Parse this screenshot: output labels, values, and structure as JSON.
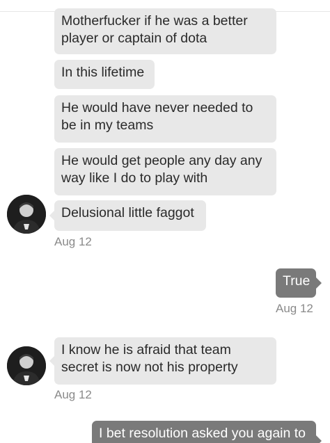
{
  "conversation": {
    "messages": [
      {
        "lines": [
          "Motherfucker if he was a better",
          "player or captain of dota"
        ]
      },
      {
        "lines": [
          "In this lifetime"
        ]
      },
      {
        "lines": [
          "He would have never needed to",
          "be in my teams"
        ]
      },
      {
        "lines": [
          "He would get people any day any",
          "way like I do to play with"
        ]
      },
      {
        "lines": [
          "Delusional little faggot"
        ],
        "timestamp": "Aug 12"
      },
      {
        "lines": [
          "True"
        ],
        "timestamp": "Aug 12"
      },
      {
        "lines": [
          "I know he is afraid that team",
          "secret is now not his property"
        ],
        "timestamp": "Aug 12"
      },
      {
        "lines": [
          "I bet resolution asked you again to"
        ]
      }
    ]
  },
  "colors": {
    "incoming_bubble": "#e8e8e8",
    "outgoing_bubble": "#7a7a7a",
    "timestamp_text": "#8a8a8a"
  },
  "icons": {
    "avatar": "contact-avatar"
  }
}
